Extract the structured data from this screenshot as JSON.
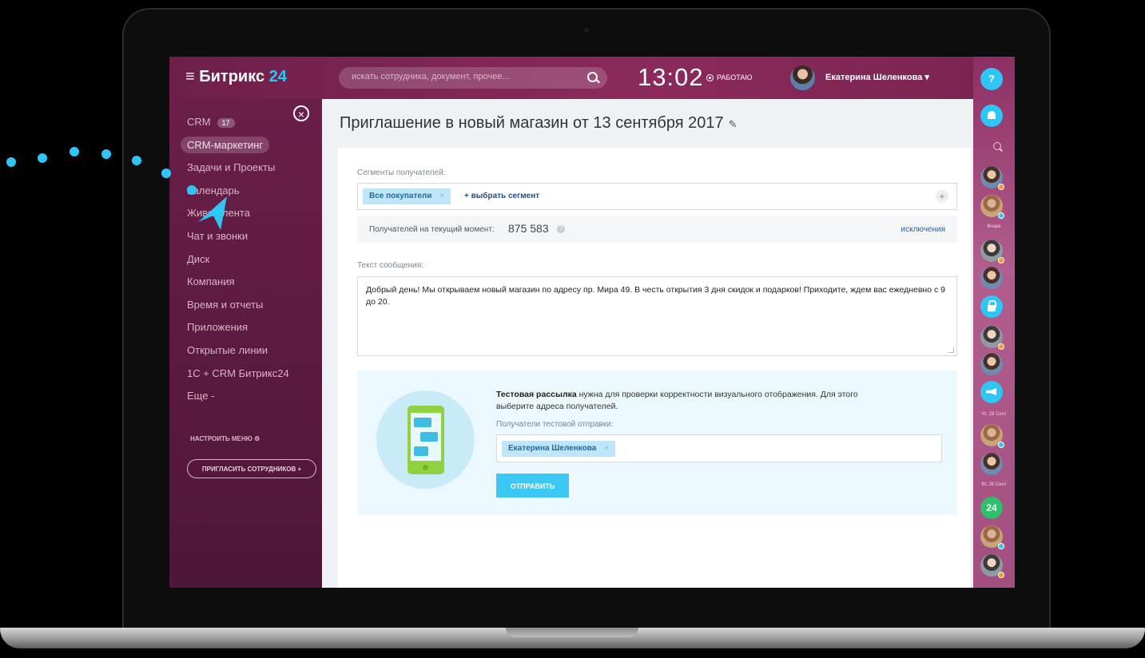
{
  "header": {
    "logo_text": "≡ Битрикс",
    "logo_num": "24",
    "search_placeholder": "искать сотрудника, документ, прочее...",
    "clock": "13:02",
    "status": "РАБОТАЮ",
    "user_name": "Екатерина Шеленкова ▾"
  },
  "sidebar": {
    "close": "×",
    "items": [
      {
        "label": "CRM",
        "badge": "17"
      },
      {
        "label": "CRM-маркетинг"
      },
      {
        "label": "Задачи и Проекты"
      },
      {
        "label": "Календарь"
      },
      {
        "label": "Живая лента"
      },
      {
        "label": "Чат и звонки"
      },
      {
        "label": "Диск"
      },
      {
        "label": "Компания"
      },
      {
        "label": "Время и отчеты"
      },
      {
        "label": "Приложения"
      },
      {
        "label": "Открытые линии"
      },
      {
        "label": "1С + CRM Битрикс24"
      },
      {
        "label": "Еще -"
      }
    ],
    "setup_menu": "НАСТРОИТЬ МЕНЮ ⚙",
    "invite": "ПРИГЛАСИТЬ СОТРУДНИКОВ +"
  },
  "main": {
    "title": "Приглашение в новый магазин от 13 сентября 2017",
    "segments_label": "Сегменты получателей:",
    "segment_tag": "Все покупатели",
    "tag_remove": "×",
    "add_segment": "+ выбрать сегмент",
    "plus": "+",
    "recipients_label": "Получателей на текущий момент:",
    "recipients_count": "875 583",
    "help": "?",
    "exceptions": "исключения",
    "message_label": "Текст сообщения:",
    "message_text": "Добрый день! Мы открываем новый магазин по адресу пр. Мира 49. В честь открытия 3 дня скидок и подарков! Приходите, ждем вас ежедневно с 9 до 20.",
    "test": {
      "desc_bold": "Тестовая рассылка",
      "desc_rest": " нужна для проверки корректности визуального отображения. Для этого выберите адреса получателей.",
      "recipients_label": "Получатели тестовой отправки:",
      "recipient": "Екатерина Шеленкова",
      "send": "ОТПРАВИТЬ"
    }
  },
  "rail": {
    "help": "?",
    "date_yesterday": "Вчера",
    "date_thu": "Чт, 28 Сент",
    "date_tue": "Вт, 26 Сент",
    "b24": "24"
  },
  "colors": {
    "header": "#7a2453",
    "sidebar": "#5a1a3f",
    "accent": "#2fc6f6",
    "send_button": "#3bc8f5"
  }
}
